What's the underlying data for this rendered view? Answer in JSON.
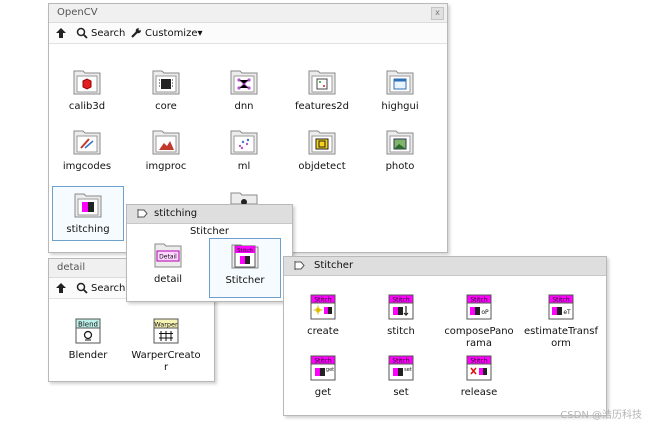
{
  "opencv": {
    "title": "OpenCV",
    "close": "x",
    "search_label": "Search",
    "customize_label": "Customize▾",
    "items": [
      "calib3d",
      "core",
      "dnn",
      "features2d",
      "highgui",
      "imgcodes",
      "imgproc",
      "ml",
      "objdetect",
      "photo",
      "stitching"
    ]
  },
  "detail": {
    "title": "detail",
    "search_label": "Search",
    "items": [
      "Blender",
      "WarperCreato\nr"
    ],
    "icon_texts": [
      "Blend",
      "Warper"
    ]
  },
  "stitching": {
    "title": "stitching",
    "section_label": "Stitcher",
    "items": [
      "detail",
      "Stitcher"
    ],
    "icon_texts": [
      "Detail",
      "Stitch"
    ]
  },
  "stitcher": {
    "title": "Stitcher",
    "items": [
      "create",
      "stitch",
      "composePano\nrama",
      "estimateTransf\norm",
      "get",
      "set",
      "release"
    ],
    "icon_text": "Stitch",
    "icon_suffixes": [
      "",
      "",
      "oP",
      "eT",
      "",
      "set",
      ""
    ]
  },
  "watermark": "CSDN @浩历科技",
  "colors": {
    "magenta": "#ff00ff",
    "highlight_border": "#6ea0cc",
    "titlebar": "#f0f0f0"
  }
}
